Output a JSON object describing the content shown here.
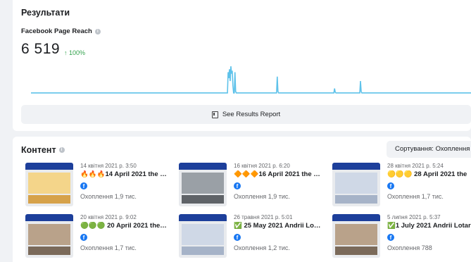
{
  "results": {
    "title": "Результати",
    "metric_name": "Facebook Page Reach",
    "metric_value": "6 519",
    "metric_change": "↑ 100%",
    "see_report_label": "See Results Report",
    "colors": {
      "line": "#5ec2ea",
      "positive": "#31a24c"
    },
    "sparkline": [
      2,
      2,
      2,
      2,
      2,
      2,
      2,
      2,
      2,
      2,
      2,
      2,
      2,
      2,
      2,
      2,
      2,
      2,
      2,
      2,
      2,
      2,
      2,
      2,
      2,
      2,
      2,
      2,
      2,
      2,
      2,
      2,
      2,
      2,
      2,
      2,
      2,
      2,
      2,
      2,
      2,
      2,
      2,
      2,
      2,
      2,
      2,
      2,
      2,
      2,
      2,
      2,
      2,
      2,
      2,
      2,
      2,
      2,
      2,
      2,
      2,
      2,
      2,
      2,
      2,
      2,
      2,
      2,
      2,
      2,
      2,
      2,
      2,
      2,
      2,
      2,
      2,
      2,
      2,
      2,
      2,
      2,
      2,
      2,
      2,
      2,
      2,
      2,
      2,
      2,
      2,
      2,
      2,
      2,
      2,
      2,
      2,
      2,
      2,
      2,
      2,
      2,
      2,
      2,
      2,
      2,
      2,
      2,
      2,
      2,
      2,
      2,
      2,
      2,
      2,
      2,
      2,
      2,
      2,
      2,
      2,
      2,
      2,
      2,
      2,
      2,
      2,
      2,
      2,
      2,
      2,
      2,
      2,
      2,
      2,
      2,
      2,
      2,
      2,
      2,
      2,
      2,
      2,
      2,
      2,
      2,
      2,
      2,
      2,
      2,
      2,
      2,
      2,
      2,
      2,
      2,
      2,
      2,
      2,
      2,
      2,
      2,
      2,
      2,
      2,
      2,
      2,
      2,
      2,
      2,
      2,
      2,
      2,
      2,
      2,
      2,
      2,
      2,
      2,
      2,
      2,
      2,
      2,
      2,
      2,
      2,
      2,
      2,
      2,
      2,
      2,
      2,
      2,
      2,
      2,
      2,
      2,
      2,
      2,
      2,
      2,
      2,
      2,
      2,
      2,
      2,
      2,
      2,
      2,
      2,
      2,
      2,
      2,
      2,
      2,
      2,
      2,
      2,
      2,
      2,
      2,
      2,
      2,
      2,
      2,
      2,
      2,
      2,
      2,
      2,
      2,
      2,
      2,
      2,
      2,
      2,
      2,
      2,
      2,
      2,
      2,
      2,
      2,
      2,
      2,
      2,
      2,
      2,
      2,
      2,
      2,
      2,
      2,
      2,
      2,
      2,
      2,
      2,
      2,
      2,
      2,
      2,
      2,
      2,
      2,
      2,
      2,
      2,
      2,
      2,
      2,
      2,
      2,
      2,
      2,
      2,
      2,
      2,
      2,
      2,
      2,
      2,
      2,
      2,
      2,
      2,
      2,
      2,
      2,
      30,
      22,
      34,
      18,
      38,
      28,
      32,
      12,
      2,
      2,
      30,
      4,
      2,
      2,
      2,
      2,
      2,
      2,
      2,
      2,
      2,
      2,
      2,
      2,
      2,
      2,
      2,
      2,
      2,
      2,
      2,
      2,
      2,
      2,
      2,
      2,
      2,
      2,
      2,
      2,
      2,
      2,
      2,
      2,
      2,
      2,
      2,
      2,
      2,
      2,
      2,
      2,
      2,
      2,
      2,
      2,
      2,
      2,
      2,
      2,
      2,
      2,
      2,
      2,
      2,
      2,
      2,
      2,
      2,
      2,
      2,
      2,
      24,
      4,
      2,
      2,
      2,
      2,
      2,
      2,
      2,
      2,
      2,
      2,
      2,
      2,
      2,
      2,
      2,
      2,
      2,
      2,
      2,
      2,
      2,
      2,
      2,
      2,
      2,
      2,
      2,
      2,
      2,
      2,
      2,
      2,
      2,
      2,
      2,
      2,
      2,
      2,
      2,
      2,
      2,
      2,
      2,
      2,
      2,
      2,
      2,
      2,
      2,
      2,
      2,
      2,
      2,
      2,
      2,
      2,
      2,
      2,
      2,
      2,
      2,
      2,
      2,
      2,
      2,
      2,
      2,
      2,
      2,
      2,
      2,
      2,
      2,
      2,
      2,
      2,
      2,
      2,
      2,
      2,
      2,
      2,
      8,
      3,
      2,
      2,
      2,
      2,
      2,
      2,
      2,
      2,
      2,
      2,
      2,
      2,
      2,
      2,
      2,
      2,
      2,
      2,
      2,
      2,
      2,
      2,
      2,
      2,
      2,
      2,
      2,
      2,
      2,
      2,
      2,
      2,
      2,
      2,
      2,
      2,
      18,
      4,
      2,
      2,
      2,
      2,
      2,
      2,
      2,
      2,
      2,
      2,
      2,
      2,
      2,
      2,
      2,
      2,
      2,
      2,
      2,
      2,
      2,
      2,
      2,
      2,
      2,
      2,
      2,
      2,
      2,
      2,
      2,
      2,
      2,
      2,
      2,
      2,
      2,
      2,
      2,
      2,
      2,
      2,
      2,
      2,
      2,
      2,
      2,
      2,
      2,
      2,
      2,
      2,
      2,
      2,
      2,
      2,
      2,
      2,
      2,
      2,
      2,
      2,
      2,
      2,
      2,
      2,
      2,
      2,
      2,
      2,
      2,
      2,
      2,
      2,
      2,
      2,
      2,
      2,
      2,
      2,
      2,
      2,
      2,
      2,
      2,
      2,
      2,
      2,
      2,
      2,
      2,
      2,
      2,
      2,
      2,
      2,
      2,
      2,
      2,
      2,
      2,
      2,
      2,
      2,
      2,
      2,
      2,
      2,
      2,
      2,
      2,
      2,
      2,
      2,
      2,
      2,
      2,
      2,
      2,
      2,
      2,
      2,
      2,
      2,
      2,
      2,
      2,
      2,
      2,
      2,
      2,
      2,
      2,
      2,
      2,
      2,
      2,
      2,
      2,
      2,
      2,
      2,
      2,
      2,
      2,
      2,
      2,
      2,
      2,
      2,
      2,
      2,
      2,
      2,
      2,
      2,
      2,
      2,
      2,
      2,
      2
    ]
  },
  "content": {
    "title": "Контент",
    "sort_label": "Сортування: Охоплення",
    "posts": [
      {
        "date": "14 квітня 2021 р. 3:50",
        "title": "🔥🔥🔥14 April 2021 the Onl…",
        "reach": "Охоплення  1,9 тис.",
        "network_icon": "facebook-icon",
        "thumb_style": "warm"
      },
      {
        "date": "16 квітня 2021 р. 6:20",
        "title": "🔶🔶🔶16 April 2021 the …",
        "reach": "Охоплення  1,9 тис.",
        "network_icon": "facebook-icon",
        "thumb_style": "grid"
      },
      {
        "date": "28 квітня 2021 р. 5:24",
        "title": "🟡🟡🟡 28 April 2021 the",
        "reach": "Охоплення  1,7 тис.",
        "network_icon": "facebook-icon",
        "thumb_style": "default"
      },
      {
        "date": "20 квітня 2021 р. 9:02",
        "title": "🟢🟢🟢 20 April 2021 the …",
        "reach": "Охоплення  1,7 тис.",
        "network_icon": "facebook-icon",
        "thumb_style": "photo"
      },
      {
        "date": "26 травня 2021 р. 5:01",
        "title": "✅ 25 May 2021 Andrii Lota…",
        "reach": "Охоплення  1,2 тис.",
        "network_icon": "facebook-icon",
        "thumb_style": "default"
      },
      {
        "date": "5 липня 2021 р. 5:37",
        "title": "✅1 July 2021 Andrii Lotari",
        "reach": "Охоплення  788",
        "network_icon": "facebook-icon",
        "thumb_style": "photo"
      }
    ]
  }
}
